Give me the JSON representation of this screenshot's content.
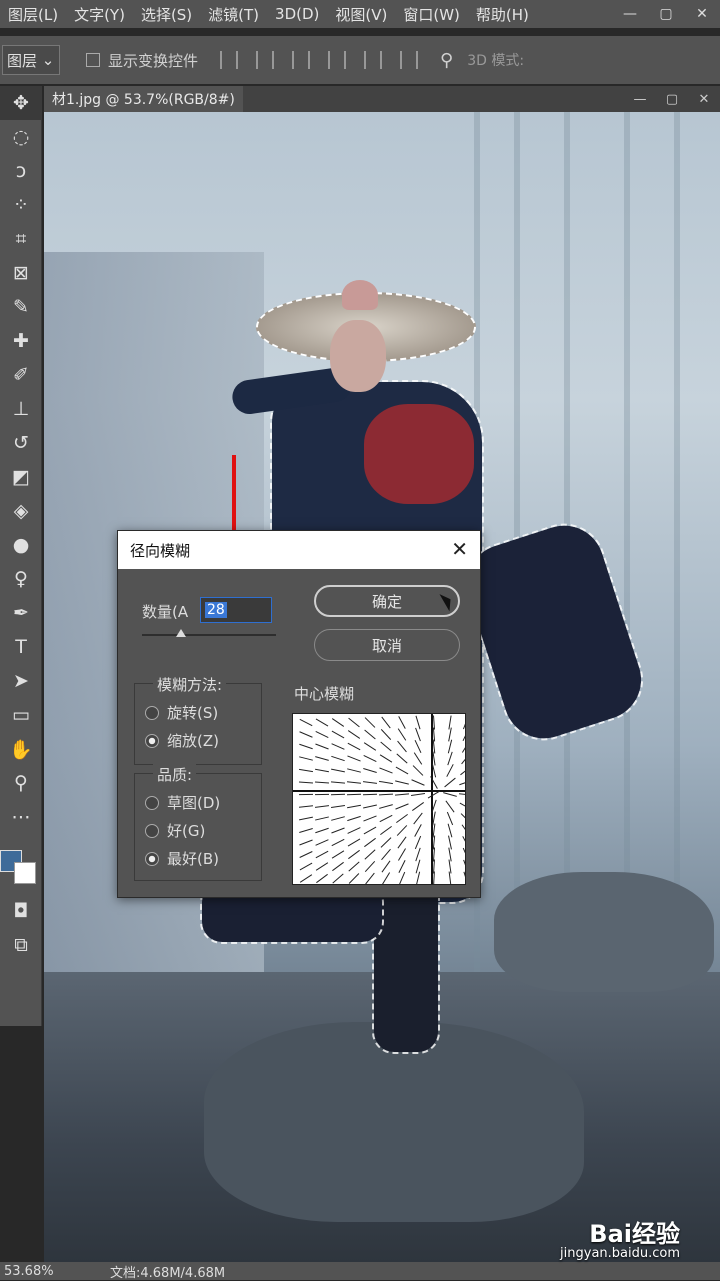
{
  "menu": [
    "图层(L)",
    "文字(Y)",
    "选择(S)",
    "滤镜(T)",
    "3D(D)",
    "视图(V)",
    "窗口(W)",
    "帮助(H)"
  ],
  "options": {
    "layer_select": "图层",
    "show_transform": "显示变换控件",
    "mode_3d": "3D 模式:"
  },
  "document_tab": "材1.jpg @ 53.7%(RGB/8#)",
  "dialog": {
    "title": "径向模糊",
    "amount_label": "数量(A",
    "amount_value": "28",
    "ok": "确定",
    "cancel": "取消",
    "blur_method_title": "模糊方法:",
    "method_spin": "旋转(S)",
    "method_zoom": "缩放(Z)",
    "quality_title": "品质:",
    "quality_draft": "草图(D)",
    "quality_good": "好(G)",
    "quality_best": "最好(B)",
    "center_label": "中心模糊"
  },
  "status": {
    "zoom": "53.68%",
    "doc": "文档:4.68M/4.68M"
  },
  "watermark": {
    "brand": "Bai经验",
    "url": "jingyan.baidu.com"
  }
}
